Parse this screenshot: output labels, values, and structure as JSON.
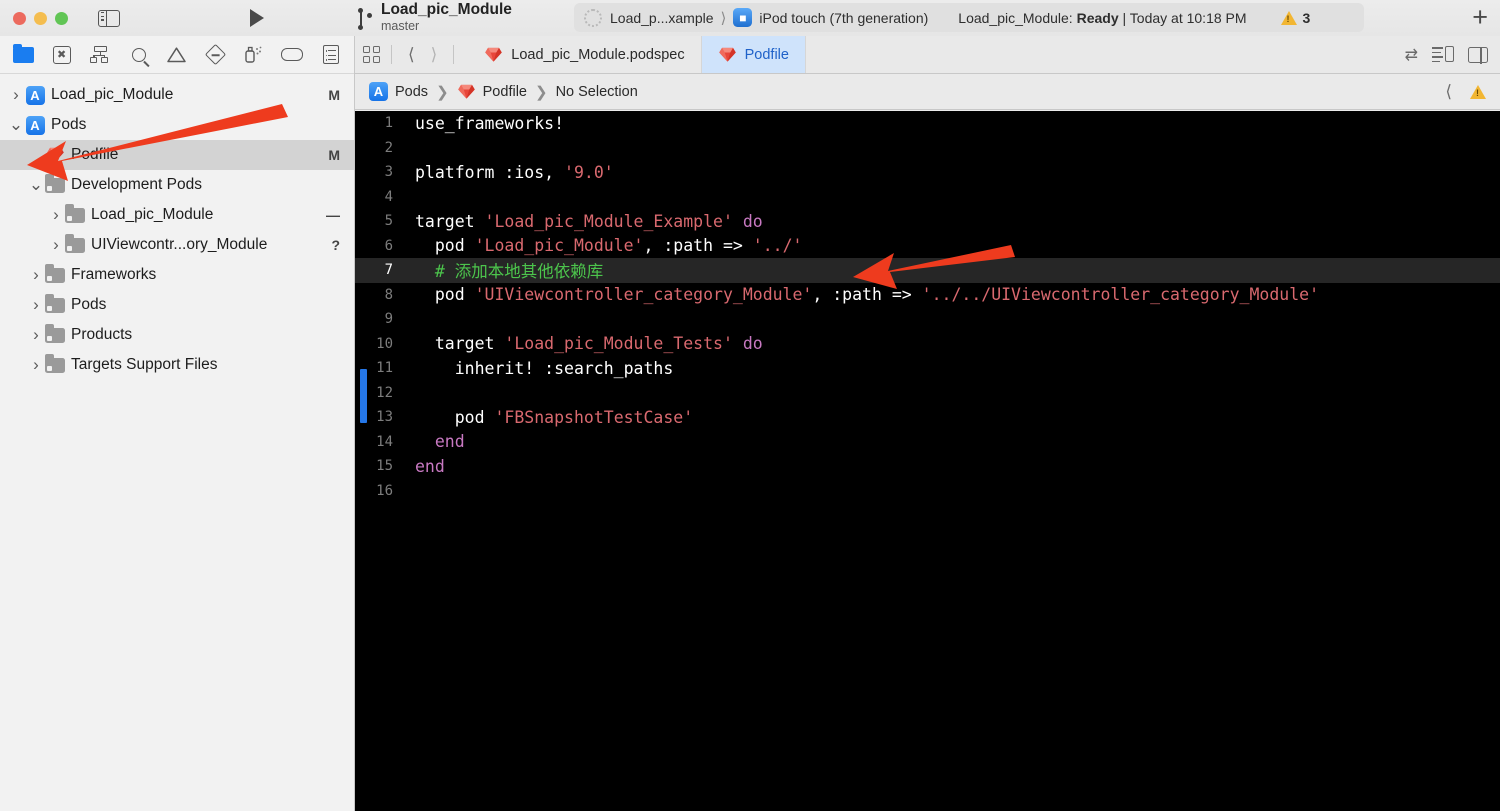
{
  "window": {
    "traffic_lights": [
      "close",
      "minimize",
      "zoom"
    ],
    "sidebar_toggle": "sidebar-toggle-icon",
    "run_label": "run",
    "project_name": "Load_pic_Module",
    "branch_name": "master"
  },
  "scheme_bar": {
    "scheme_name": "Load_p...xample",
    "destination": "iPod touch (7th generation)",
    "status_prefix": "Load_pic_Module:",
    "status_state": "Ready",
    "status_time": "| Today at 10:18 PM",
    "warning_count": "3",
    "add_button": "+"
  },
  "navigator": {
    "toolbar_icons": [
      "project-navigator-icon",
      "source-control-navigator-icon",
      "symbol-navigator-icon",
      "find-navigator-icon",
      "issue-navigator-icon",
      "test-navigator-icon",
      "debug-navigator-icon",
      "breakpoint-navigator-icon",
      "report-navigator-icon"
    ],
    "tree": [
      {
        "label": "Load_pic_Module",
        "icon": "xcode-project-icon",
        "badge": "M",
        "indent": 0,
        "disclosure": "closed",
        "selected": false
      },
      {
        "label": "Pods",
        "icon": "xcode-project-icon",
        "badge": "",
        "indent": 0,
        "disclosure": "open",
        "selected": false
      },
      {
        "label": "Podfile",
        "icon": "ruby-gem-icon",
        "badge": "M",
        "indent": 1,
        "disclosure": "none",
        "selected": true
      },
      {
        "label": "Development Pods",
        "icon": "folder-icon",
        "badge": "",
        "indent": 1,
        "disclosure": "open",
        "selected": false
      },
      {
        "label": "Load_pic_Module",
        "icon": "folder-icon",
        "badge": "—",
        "indent": 2,
        "disclosure": "closed",
        "selected": false
      },
      {
        "label": "UIViewcontr...ory_Module",
        "icon": "folder-icon",
        "badge": "?",
        "indent": 2,
        "disclosure": "closed",
        "selected": false
      },
      {
        "label": "Frameworks",
        "icon": "folder-icon",
        "badge": "",
        "indent": 1,
        "disclosure": "closed",
        "selected": false
      },
      {
        "label": "Pods",
        "icon": "folder-icon",
        "badge": "",
        "indent": 1,
        "disclosure": "closed",
        "selected": false
      },
      {
        "label": "Products",
        "icon": "folder-icon",
        "badge": "",
        "indent": 1,
        "disclosure": "closed",
        "selected": false
      },
      {
        "label": "Targets Support Files",
        "icon": "folder-icon",
        "badge": "",
        "indent": 1,
        "disclosure": "closed",
        "selected": false
      }
    ]
  },
  "editor": {
    "tabs": [
      {
        "label": "Load_pic_Module.podspec",
        "icon": "ruby-gem-icon",
        "active": false
      },
      {
        "label": "Podfile",
        "icon": "ruby-gem-icon",
        "active": true
      }
    ],
    "breadcrumb": [
      {
        "label": "Pods",
        "icon": "xcode-project-icon"
      },
      {
        "label": "Podfile",
        "icon": "ruby-gem-icon"
      },
      {
        "label": "No Selection",
        "icon": ""
      }
    ],
    "lines": [
      {
        "n": "1",
        "tokens": [
          {
            "t": "use_frameworks!",
            "c": "plain"
          }
        ],
        "highlight": false
      },
      {
        "n": "2",
        "tokens": [],
        "highlight": false
      },
      {
        "n": "3",
        "tokens": [
          {
            "t": "platform :ios, ",
            "c": "plain"
          },
          {
            "t": "'9.0'",
            "c": "str"
          }
        ],
        "highlight": false
      },
      {
        "n": "4",
        "tokens": [],
        "highlight": false
      },
      {
        "n": "5",
        "tokens": [
          {
            "t": "target ",
            "c": "plain"
          },
          {
            "t": "'Load_pic_Module_Example'",
            "c": "str"
          },
          {
            "t": " ",
            "c": "plain"
          },
          {
            "t": "do",
            "c": "kw"
          }
        ],
        "highlight": false
      },
      {
        "n": "6",
        "tokens": [
          {
            "t": "  pod ",
            "c": "plain"
          },
          {
            "t": "'Load_pic_Module'",
            "c": "str"
          },
          {
            "t": ", :path => ",
            "c": "plain"
          },
          {
            "t": "'../'",
            "c": "str"
          }
        ],
        "highlight": false
      },
      {
        "n": "7",
        "tokens": [
          {
            "t": "  # 添加本地其他依赖库",
            "c": "com"
          }
        ],
        "highlight": true
      },
      {
        "n": "8",
        "tokens": [
          {
            "t": "  pod ",
            "c": "plain"
          },
          {
            "t": "'UIViewcontroller_category_Module'",
            "c": "str"
          },
          {
            "t": ", :path => ",
            "c": "plain"
          },
          {
            "t": "'../../UIViewcontroller_category_Module'",
            "c": "str"
          }
        ],
        "highlight": false
      },
      {
        "n": "9",
        "tokens": [],
        "highlight": false
      },
      {
        "n": "10",
        "tokens": [
          {
            "t": "  target ",
            "c": "plain"
          },
          {
            "t": "'Load_pic_Module_Tests'",
            "c": "str"
          },
          {
            "t": " ",
            "c": "plain"
          },
          {
            "t": "do",
            "c": "kw"
          }
        ],
        "highlight": false
      },
      {
        "n": "11",
        "tokens": [
          {
            "t": "    inherit! :search_paths",
            "c": "plain"
          }
        ],
        "highlight": false
      },
      {
        "n": "12",
        "tokens": [],
        "highlight": false
      },
      {
        "n": "13",
        "tokens": [
          {
            "t": "    pod ",
            "c": "plain"
          },
          {
            "t": "'FBSnapshotTestCase'",
            "c": "str"
          }
        ],
        "highlight": false
      },
      {
        "n": "14",
        "tokens": [
          {
            "t": "  ",
            "c": "plain"
          },
          {
            "t": "end",
            "c": "kw"
          }
        ],
        "highlight": false
      },
      {
        "n": "15",
        "tokens": [
          {
            "t": "end",
            "c": "kw"
          }
        ],
        "highlight": false
      },
      {
        "n": "16",
        "tokens": [],
        "highlight": false
      }
    ]
  },
  "annotations": {
    "arrow_color": "#ee3b1e",
    "arrows": [
      {
        "name": "arrow-pointing-to-podfile"
      },
      {
        "name": "arrow-pointing-to-comment-line"
      }
    ]
  },
  "colors": {
    "editor_background": "#000000",
    "highlight_line": "#262626",
    "string_token": "#d9696f",
    "keyword_token": "#c879c2",
    "comment_token": "#4cc54c",
    "change_bar": "#2577e8",
    "tab_active": "#cfe3fb",
    "accent_blue": "#2062c9"
  }
}
